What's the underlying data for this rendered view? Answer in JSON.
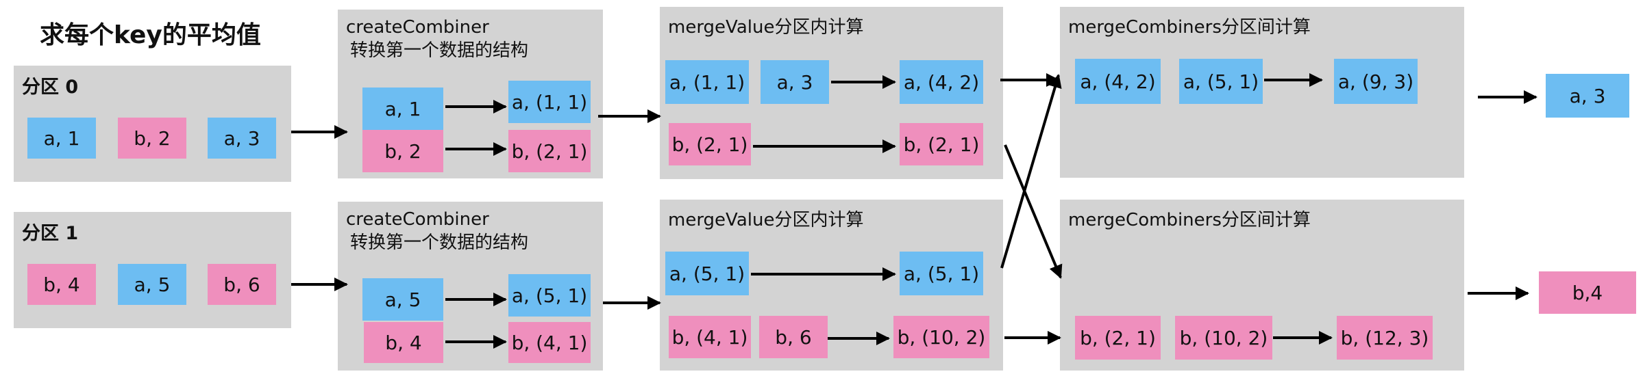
{
  "title": "求每个key的平均值",
  "colors": {
    "key_a": "#6dbdf2",
    "key_b": "#ef8fbd",
    "panel": "#d3d3d3"
  },
  "partitions": [
    {
      "label": "分区 0",
      "items": [
        "a, 1",
        "b, 2",
        "a, 3"
      ]
    },
    {
      "label": "分区 1",
      "items": [
        "b, 4",
        "a, 5",
        "b, 6"
      ]
    }
  ],
  "create_combiner": [
    {
      "title_line1": "createCombiner",
      "title_line2": "转换第一个数据的结构",
      "rows": [
        {
          "in": "a, 1",
          "out": "a, (1, 1)"
        },
        {
          "in": "b, 2",
          "out": "b, (2, 1)"
        }
      ]
    },
    {
      "title_line1": "createCombiner",
      "title_line2": "转换第一个数据的结构",
      "rows": [
        {
          "in": "a, 5",
          "out": "a, (5, 1)"
        },
        {
          "in": "b, 4",
          "out": "b, (4, 1)"
        }
      ]
    }
  ],
  "merge_value": [
    {
      "title": "mergeValue分区内计算",
      "row1": {
        "in1": "a, (1, 1)",
        "in2": "a, 3",
        "out": "a, (4, 2)"
      },
      "row2": {
        "in1": "b, (2, 1)",
        "out": "b, (2, 1)"
      }
    },
    {
      "title": "mergeValue分区内计算",
      "row1": {
        "in1": "a, (5, 1)",
        "out": "a, (5, 1)"
      },
      "row2": {
        "in1": "b, (4, 1)",
        "in2": "b, 6",
        "out": "b, (10, 2)"
      }
    }
  ],
  "merge_combiners": [
    {
      "title": "mergeCombiners分区间计算",
      "row": {
        "in1": "a, (4, 2)",
        "in2": "a, (5, 1)",
        "out": "a, (9, 3)"
      }
    },
    {
      "title": "mergeCombiners分区间计算",
      "row": {
        "in1": "b, (2, 1)",
        "in2": "b, (10, 2)",
        "out": "b, (12, 3)"
      }
    }
  ],
  "results": [
    "a, 3",
    "b,4"
  ]
}
